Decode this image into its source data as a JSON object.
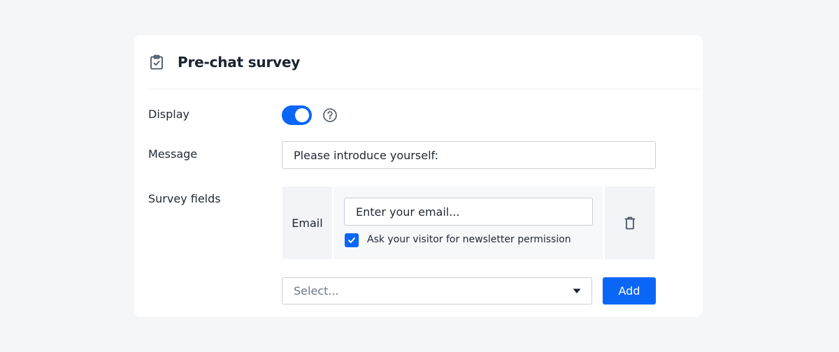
{
  "header": {
    "title": "Pre-chat survey",
    "icon": "clipboard-check-icon"
  },
  "display": {
    "label": "Display",
    "enabled": true,
    "toggle_color": "#0a66f7",
    "help_icon": "question-circle-icon"
  },
  "message": {
    "label": "Message",
    "value": "Please introduce yourself:"
  },
  "survey_fields": {
    "label": "Survey fields",
    "fields": [
      {
        "name": "Email",
        "placeholder": "Enter your email...",
        "newsletter_checkbox": {
          "checked": true,
          "label": "Ask your visitor for newsletter permission"
        },
        "delete_icon": "trash-icon"
      }
    ],
    "add_select": {
      "placeholder": "Select...",
      "caret_icon": "caret-down-icon"
    },
    "add_button_label": "Add"
  },
  "colors": {
    "accent": "#0a66f7",
    "background": "#f5f6f8",
    "card": "#ffffff"
  }
}
